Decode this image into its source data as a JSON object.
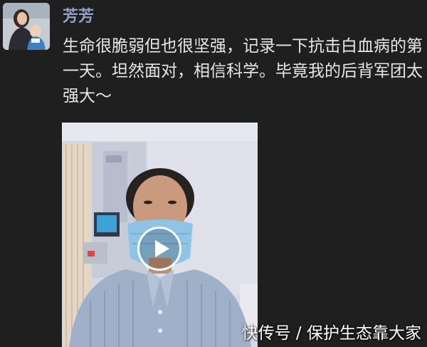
{
  "post": {
    "username": "芳芳",
    "text": "生命很脆弱但也很坚强，记录一下抗击白血病的第一天。坦然面对，相信科学。毕竟我的后背军团太强大～"
  },
  "video": {
    "play_icon": "play-icon"
  },
  "watermark": {
    "text": "快传号 / 保护生态靠大家"
  },
  "colors": {
    "background": "#1f1f1f",
    "username": "#8fa1c8",
    "post_text": "#e6e6e6",
    "watermark": "#ffffff"
  }
}
